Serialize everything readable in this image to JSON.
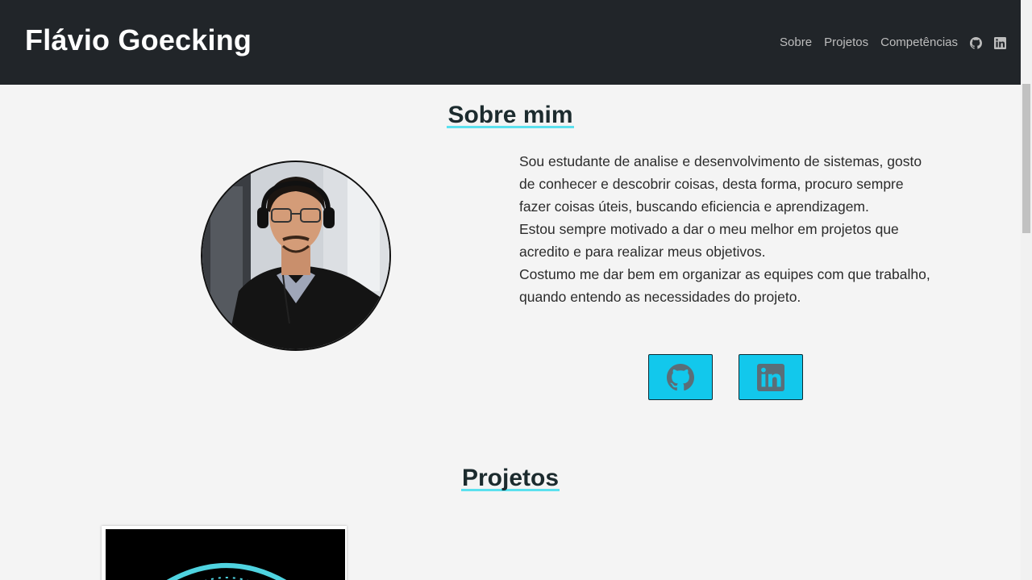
{
  "navbar": {
    "brand": "Flávio Goecking",
    "links": [
      "Sobre",
      "Projetos",
      "Competências"
    ],
    "icons": [
      "github-icon",
      "linkedin-icon"
    ]
  },
  "about": {
    "title": "Sobre mim",
    "paragraphs": [
      "Sou estudante de analise e desenvolvimento de sistemas, gosto de conhecer e descobrir coisas, desta forma, procuro sempre fazer coisas úteis, buscando eficiencia e aprendizagem.",
      "Estou sempre motivado a dar o meu melhor em projetos que acredito e para realizar meus objetivos.",
      "Costumo me dar bem em organizar as equipes com que trabalho, quando entendo as necessidades do projeto."
    ],
    "social_buttons": [
      "github-icon",
      "linkedin-icon"
    ]
  },
  "projects": {
    "title": "Projetos"
  },
  "colors": {
    "navbar_bg": "#212529",
    "page_bg": "#f4f4f4",
    "accent": "#12c8ec",
    "underline": "#5be1ee",
    "icon_on_button": "#5a6e78"
  }
}
